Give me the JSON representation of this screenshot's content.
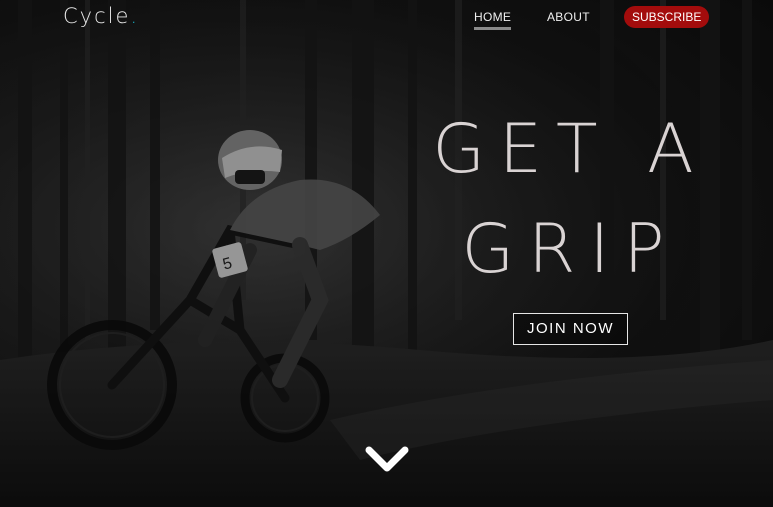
{
  "brand": {
    "name": "Cycle",
    "dot": ".",
    "dot_color": "#17b3c9"
  },
  "nav": {
    "home_label": "HOME",
    "about_label": "ABOUT",
    "subscribe_label": "SUBSCRIBE",
    "subscribe_color": "#a30c0c",
    "active_item": "HOME"
  },
  "hero": {
    "headline_line1": "GET A",
    "headline_line2": "GRIP",
    "cta_label": "JOIN NOW",
    "background_image": "mountain-biker-in-forest-black-and-white",
    "scroll_icon": "chevron-down-icon"
  }
}
